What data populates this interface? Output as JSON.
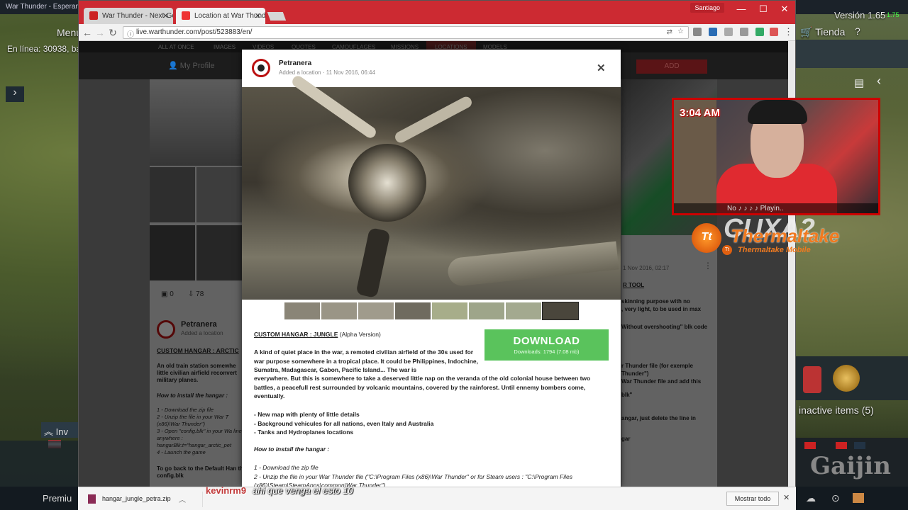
{
  "game": {
    "top_title": "War Thunder - Esperando ...",
    "menu_label": "Menú",
    "online_text": "En línea: 30938, ba",
    "version": "Versión 1.65",
    "version_small": "1.75",
    "store_label": "Tienda",
    "help": "?",
    "inactive_items": "inactive items (5)",
    "inv_label": "Inv",
    "premium_label": "Premiu",
    "up_button": "UP",
    "arrow": "›"
  },
  "browser": {
    "tabs": [
      {
        "label": "War Thunder - Next-Gen",
        "active": false
      },
      {
        "label": "Location at War Thunder",
        "active": true
      }
    ],
    "profile": "Santiago",
    "url": "live.warthunder.com/post/523883/en/",
    "win_controls": [
      "—",
      "☐",
      "✕"
    ]
  },
  "wt_site": {
    "nav": [
      "ALL AT ONCE",
      "IMAGES",
      "VIDEOS",
      "QUOTES",
      "CAMOUFLAGES",
      "MISSIONS",
      "LOCATIONS",
      "MODELS"
    ],
    "my_profile": "My Profile",
    "add_button": "ADD",
    "left_card": {
      "comments": "0",
      "downloads": "78",
      "author": "Petranera",
      "meta": "Added a location",
      "title": "CUSTOM HANGAR : ARCTIC",
      "excerpt": "An old train station somewhe little civilian airfield reconvert military planes.",
      "how_to": "How to install the hangar :",
      "steps": [
        "1 - Download the zip file",
        "2 - Unzip the file in your War T (x86)\\War Thunder\")",
        "3 - Open \"config.blk\" in your Wa line anywhere :",
        "hangarBlk:t=\"hangar_arctic_pet",
        "4 - Launch the game"
      ],
      "go_back": "To go back to the Default Han the config.blk"
    },
    "right_card": {
      "date": "1 Nov 2016, 02:17",
      "tool": "R TOOL",
      "lines": [
        "skinning purpose with no",
        ", very light, to be used in max",
        "Without overshooting\" blk code",
        "r Thunder file (for exemple",
        "Thunder\")",
        "War Thunder file and add this",
        "blk\"",
        "angar, just delete the line in",
        "gar"
      ]
    }
  },
  "modal": {
    "author": "Petranera",
    "meta_action": "Added a location",
    "meta_date": "11 Nov 2016, 06:44",
    "close": "✕",
    "title_link": "CUSTOM HANGAR : JUNGLE",
    "title_suffix": "(Alpha Version)",
    "download_label": "DOWNLOAD",
    "download_info": "Downloads: 1794 (7.08 mb)",
    "paragraph": "A kind of quiet place in the war, a remoted civilian airfield of the 30s used for war purpose somewhere in a tropical place. It could be Philippines, Indochine, Sumatra, Madagascar, Gabon, Pacific Island... The war is everywhere. But this is somewhere to take a deserved little nap on the veranda of the old colonial house between two battles, a peacefull rest surrounded by volcanic mountains, covered by the rainforest. Until ennemy bombers come, eventually.",
    "features": [
      "- New map with plenty of little details",
      "- Background vehicules for all nations, even Italy and Australia",
      "- Tanks and Hydroplanes locations"
    ],
    "how_to": "How to install the hangar :",
    "steps": [
      "1 - Download the zip file",
      "2 - Unzip the file in your War Thunder file (\"C:\\Program Files (x86)\\War Thunder\" or for Steam users : \"C:\\Program Files (x86)\\Steam\\SteamApps\\common\\War Thunder\")"
    ]
  },
  "stream": {
    "time": "3:04 AM",
    "now_playing": "No ♪ ♪ ♪ ♪ Playin..",
    "brand": "Thermaltake",
    "brand_sub": "Thermaltake Mobile",
    "chat_user": "kevinrm9",
    "chat_msg": "ahi que venga el esto 10"
  },
  "downloads": {
    "file": "hangar_jungle_petra.zip",
    "show_all": "Mostrar todo",
    "close": "✕"
  },
  "colors": {
    "chrome_red": "#cc2a32",
    "download_green": "#5ac35c",
    "wt_red": "#c3191f"
  }
}
